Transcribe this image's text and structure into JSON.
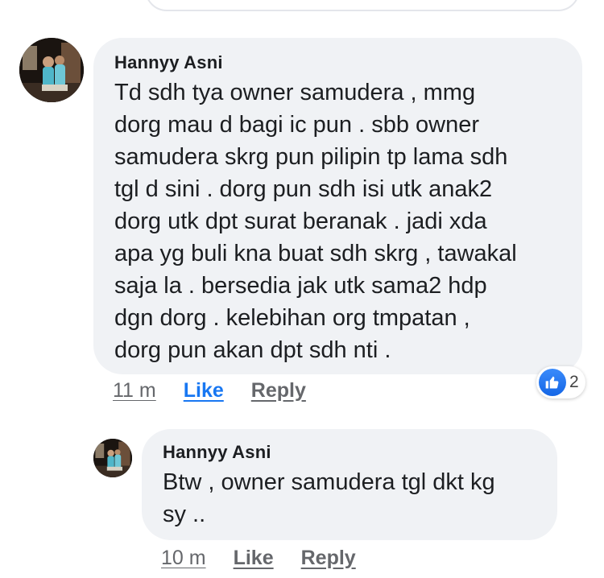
{
  "comments": [
    {
      "author": "Hannyy Asni",
      "text": "Td sdh tya owner samudera , mmg\ndorg mau d bagi ic pun . sbb owner\nsamudera skrg pun pilipin tp lama sdh\ntgl d sini . dorg pun sdh isi utk anak2\ndorg utk dpt surat beranak . jadi xda\napa yg buli kna buat sdh skrg , tawakal\nsaja la . bersedia jak utk sama2 hdp\ndgn dorg . kelebihan org tmpatan ,\ndorg pun akan dpt sdh nti .",
      "timestamp": "11 m",
      "like_label": "Like",
      "reply_label": "Reply",
      "reactions": {
        "icon": "thumbs-up-icon",
        "count": "2"
      }
    }
  ],
  "replies": [
    {
      "author": "Hannyy Asni",
      "text": "Btw , owner samudera tgl dkt kg\nsy ..",
      "timestamp": "10 m",
      "like_label": "Like",
      "reply_label": "Reply"
    }
  ],
  "colors": {
    "bubble": "#f0f2f5",
    "like_active": "#1877f2",
    "meta_gray": "#65676b",
    "reaction_blue": "#1877f2"
  }
}
